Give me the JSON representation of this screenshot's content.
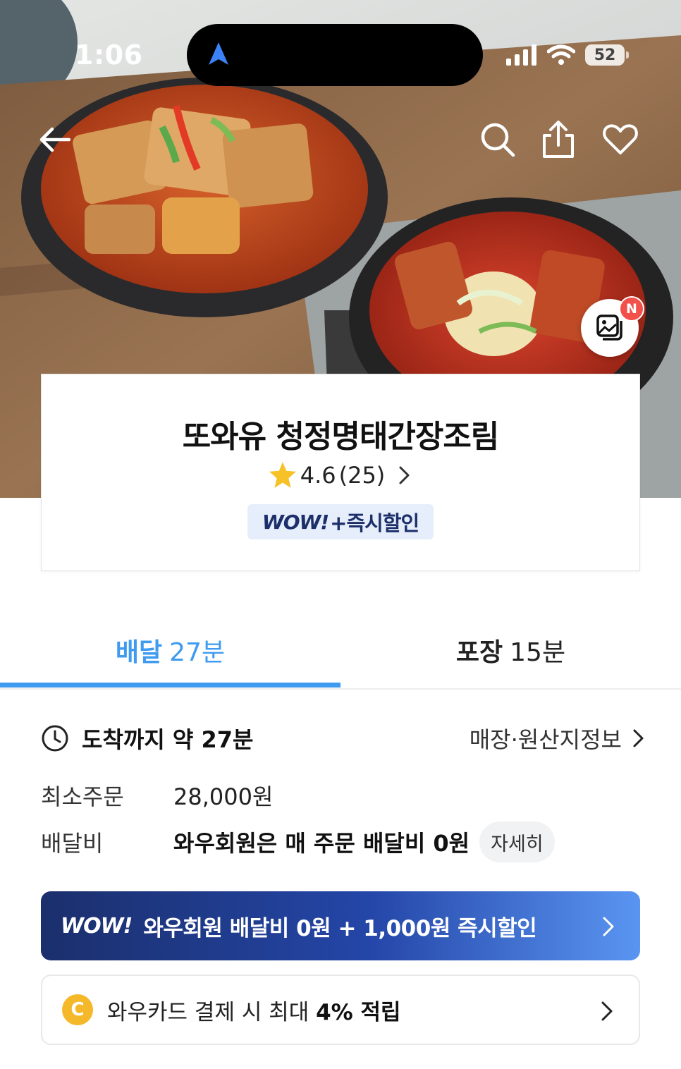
{
  "status_bar": {
    "time": "1:06",
    "battery": "52"
  },
  "store": {
    "name": "또와유 청정명태간장조림",
    "rating": "4.6",
    "review_count": "(25)",
    "wow_badge_logo": "WOW!",
    "wow_badge_text": "+즉시할인"
  },
  "gallery_badge": "N",
  "tabs": [
    {
      "label": "배달",
      "time": "27분",
      "active": true
    },
    {
      "label": "포장",
      "time": "15분",
      "active": false
    }
  ],
  "eta": {
    "text": "도착까지 약 27분"
  },
  "store_info_link": "매장·원산지정보",
  "min_order": {
    "label": "최소주문",
    "value": "28,000원"
  },
  "delivery_fee": {
    "label": "배달비",
    "value": "와우회원은 매 주문 배달비 0원",
    "detail_button": "자세히"
  },
  "wow_banner": {
    "logo": "WOW!",
    "text": "와우회원 배달비 0원 + 1,000원 즉시할인"
  },
  "card_banner": {
    "coin": "C",
    "text_prefix": "와우카드 결제 시 최대 ",
    "text_bold": "4% 적립"
  },
  "colors": {
    "accent_blue": "#3f9bf0",
    "wow_navy": "#1d2f6b",
    "badge_bg": "#e6eefb",
    "coin_gold": "#f5b82a",
    "new_badge_red": "#f2504b"
  }
}
